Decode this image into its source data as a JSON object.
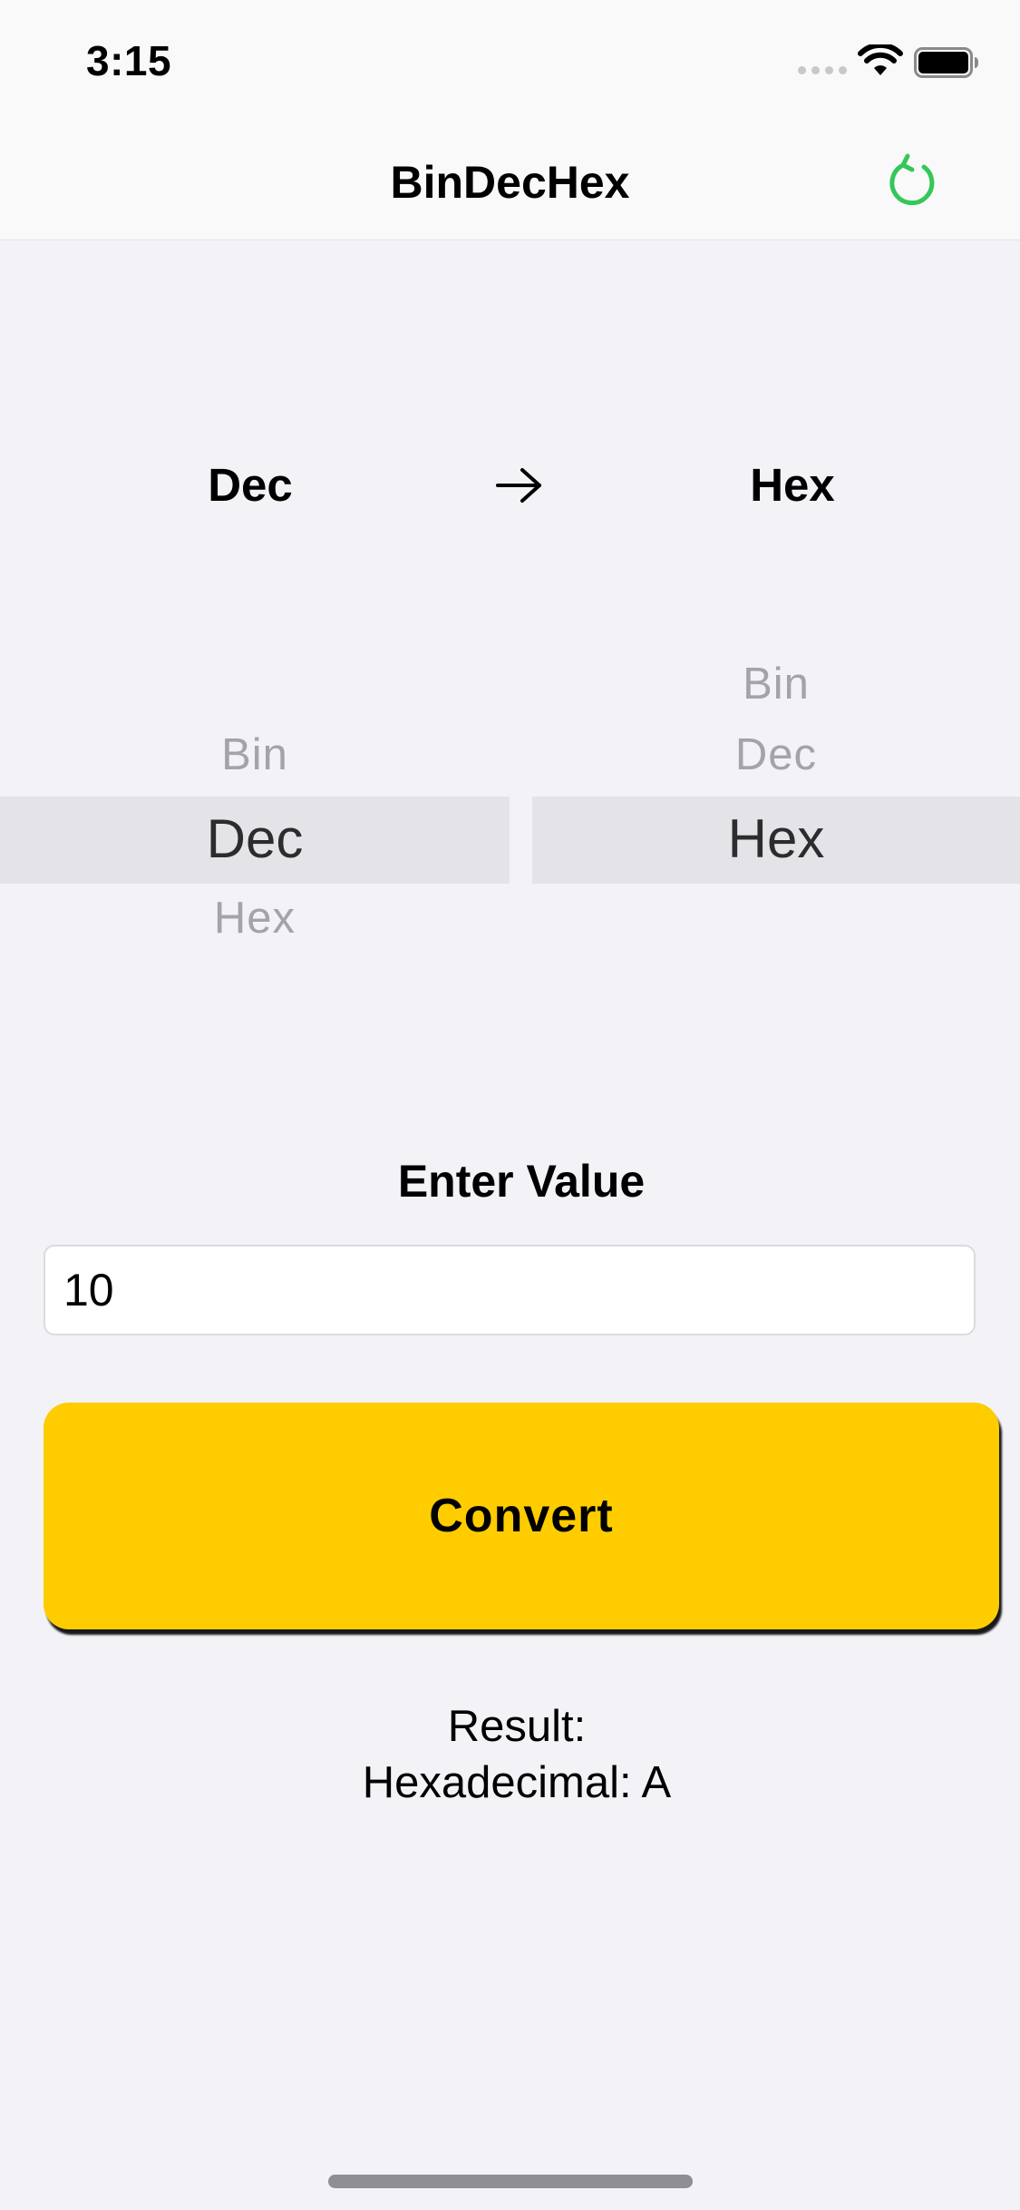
{
  "status_bar": {
    "time": "3:15"
  },
  "nav": {
    "title": "BinDecHex",
    "refresh_icon": "refresh-icon",
    "accent_color": "#34C759"
  },
  "conversion": {
    "from": "Dec",
    "to": "Hex",
    "arrow_icon": "arrow-right-icon"
  },
  "picker_from": {
    "options": [
      "Bin",
      "Dec",
      "Hex"
    ],
    "selected": "Dec"
  },
  "picker_to": {
    "options": [
      "Bin",
      "Dec",
      "Hex"
    ],
    "selected": "Hex"
  },
  "input": {
    "label": "Enter Value",
    "value": "10"
  },
  "convert_button": {
    "label": "Convert",
    "color": "#FFCC00"
  },
  "result": {
    "heading": "Result:",
    "text": "Hexadecimal: A"
  }
}
